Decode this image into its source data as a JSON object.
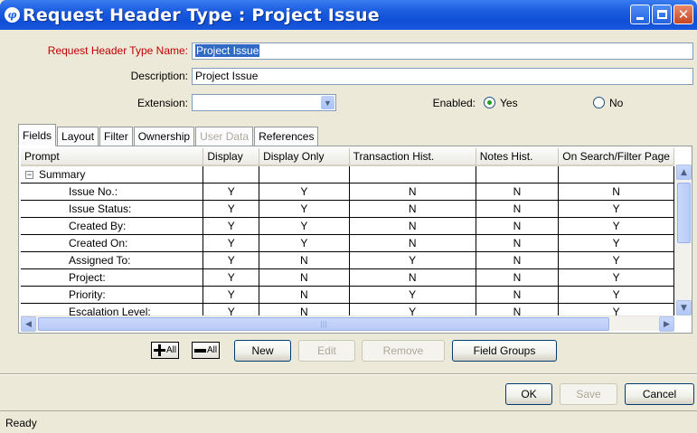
{
  "window": {
    "title": "Request Header Type : Project Issue",
    "app_icon_glyph": "φ"
  },
  "form": {
    "name_label": "Request Header Type Name:",
    "name_value": "Project Issue",
    "description_label": "Description:",
    "description_value": "Project Issue",
    "extension_label": "Extension:",
    "extension_value": "",
    "enabled_label": "Enabled:",
    "enabled_yes": "Yes",
    "enabled_no": "No",
    "enabled_selected": "Yes"
  },
  "tabs": [
    {
      "label": "Fields",
      "active": true,
      "disabled": false
    },
    {
      "label": "Layout",
      "active": false,
      "disabled": false
    },
    {
      "label": "Filter",
      "active": false,
      "disabled": false
    },
    {
      "label": "Ownership",
      "active": false,
      "disabled": false
    },
    {
      "label": "User Data",
      "active": false,
      "disabled": true
    },
    {
      "label": "References",
      "active": false,
      "disabled": false
    }
  ],
  "table": {
    "columns": [
      "Prompt",
      "Display",
      "Display Only",
      "Transaction Hist.",
      "Notes Hist.",
      "On Search/Filter Page"
    ],
    "group": "Summary",
    "rows": [
      [
        "Issue No.:",
        "Y",
        "Y",
        "N",
        "N",
        "N"
      ],
      [
        "Issue Status:",
        "Y",
        "Y",
        "N",
        "N",
        "Y"
      ],
      [
        "Created By:",
        "Y",
        "Y",
        "N",
        "N",
        "Y"
      ],
      [
        "Created On:",
        "Y",
        "Y",
        "N",
        "N",
        "Y"
      ],
      [
        "Assigned To:",
        "Y",
        "N",
        "Y",
        "N",
        "Y"
      ],
      [
        "Project:",
        "Y",
        "N",
        "N",
        "N",
        "Y"
      ],
      [
        "Priority:",
        "Y",
        "N",
        "Y",
        "N",
        "Y"
      ],
      [
        "Escalation Level:",
        "Y",
        "N",
        "Y",
        "N",
        "Y"
      ]
    ]
  },
  "toolbar": {
    "expand_all": "All",
    "collapse_all": "All",
    "new": "New",
    "edit": "Edit",
    "remove": "Remove",
    "field_groups": "Field Groups"
  },
  "footer": {
    "ok": "OK",
    "save": "Save",
    "cancel": "Cancel"
  },
  "status": "Ready"
}
